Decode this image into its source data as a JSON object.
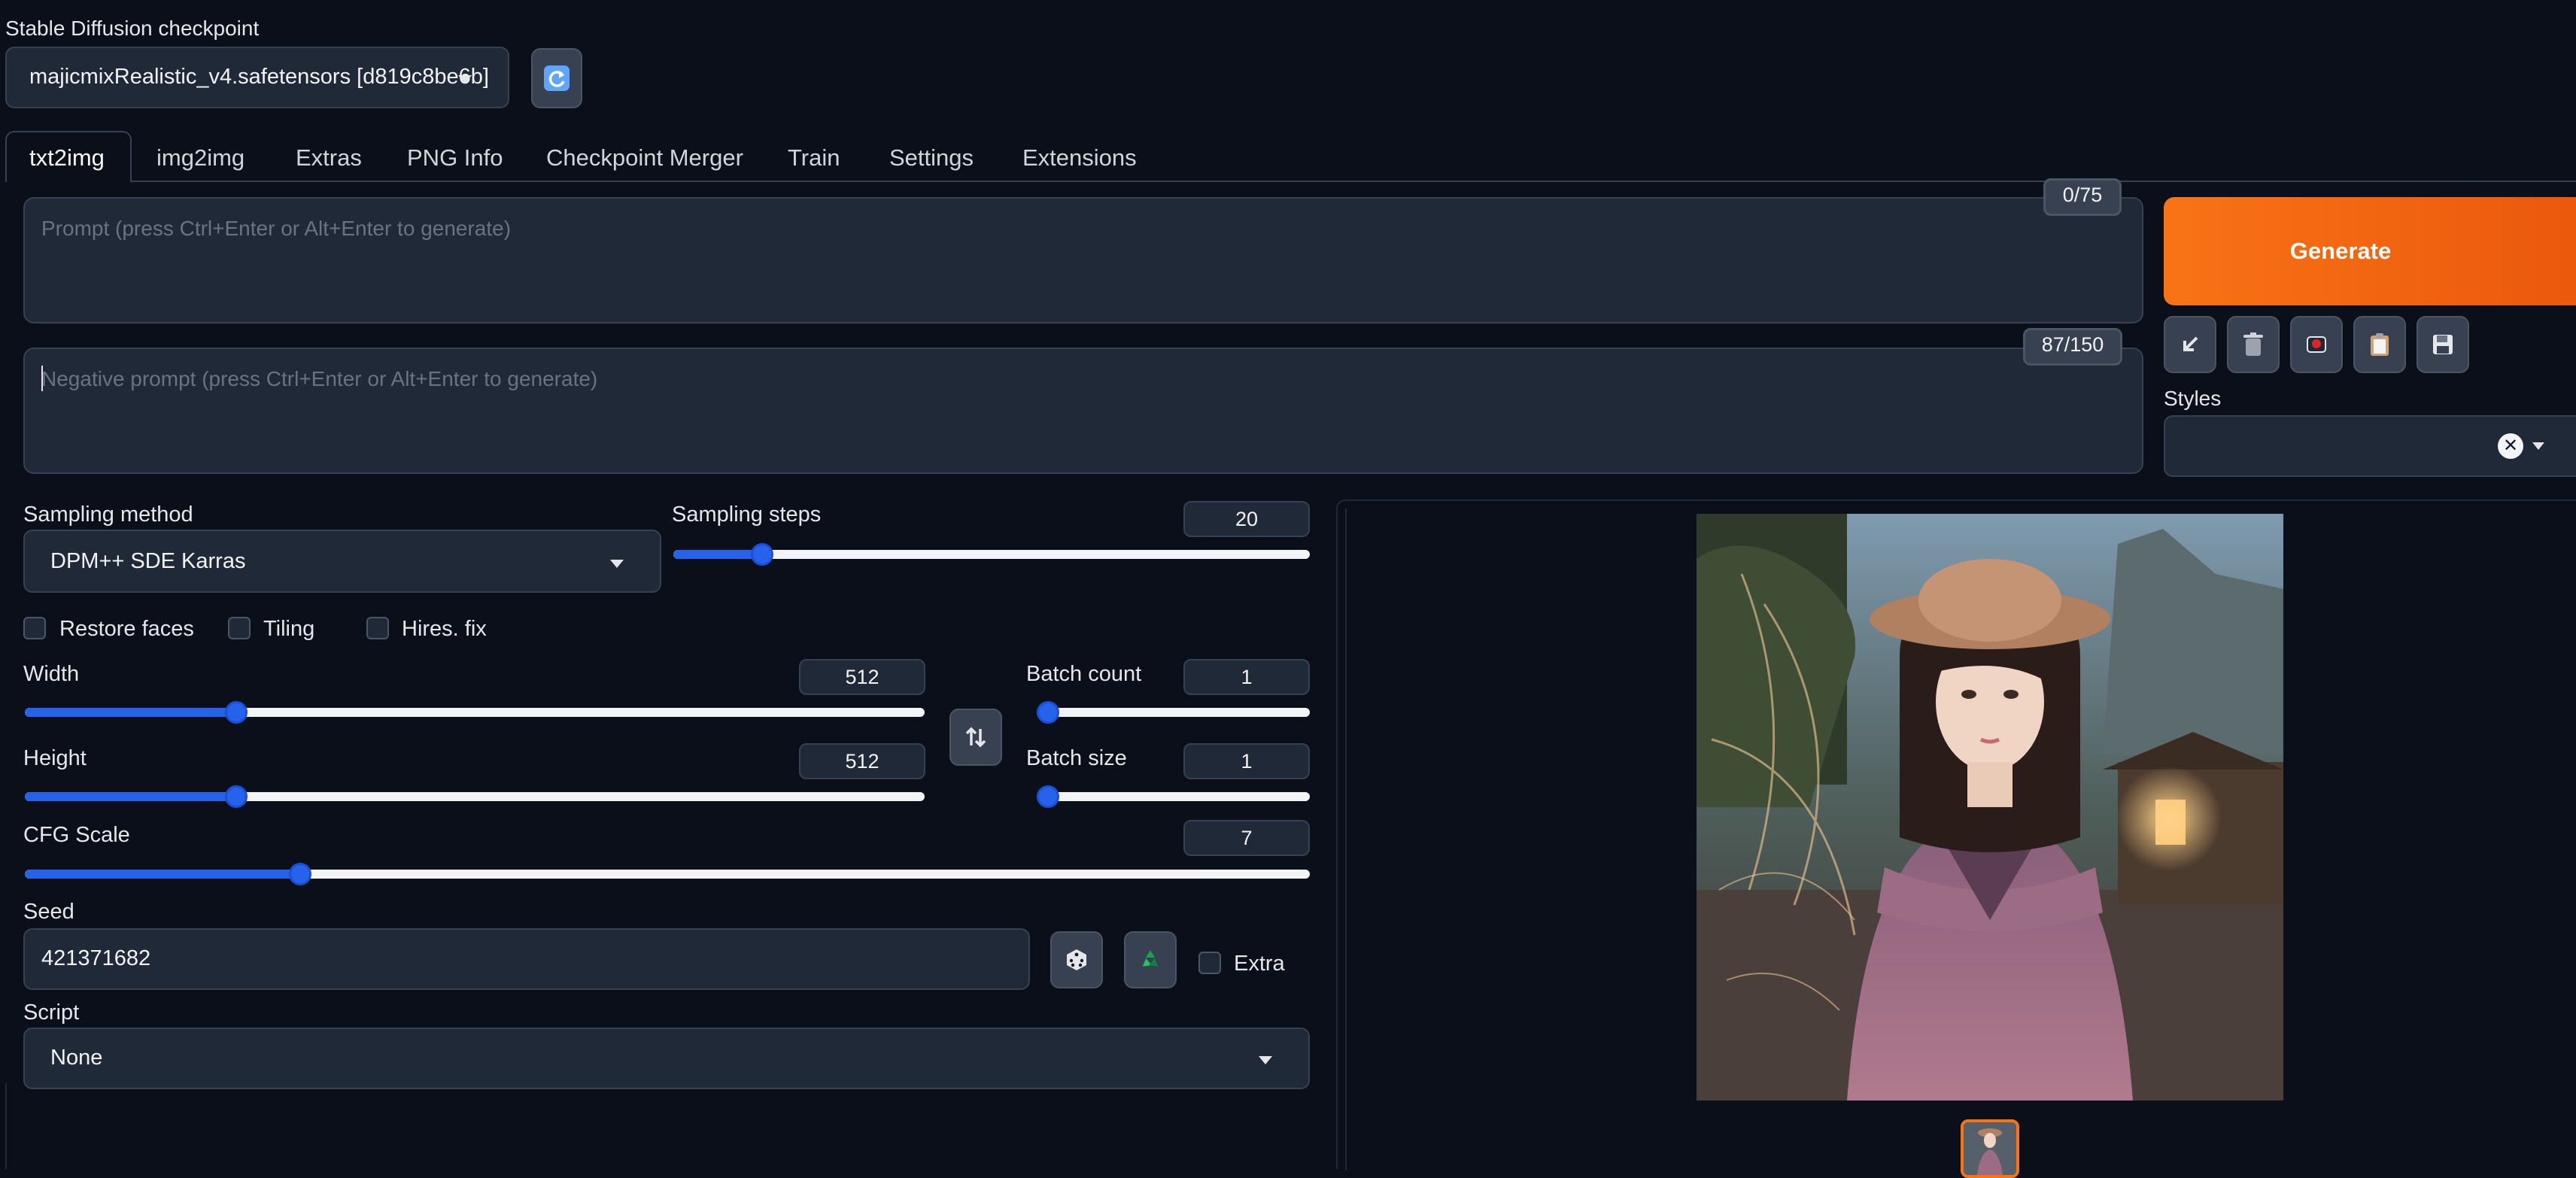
{
  "checkpoint": {
    "label": "Stable Diffusion checkpoint",
    "value": "majicmixRealistic_v4.safetensors [d819c8be6b]"
  },
  "tabs": [
    "txt2img",
    "img2img",
    "Extras",
    "PNG Info",
    "Checkpoint Merger",
    "Train",
    "Settings",
    "Extensions"
  ],
  "active_tab": "txt2img",
  "prompt": {
    "placeholder": "Prompt (press Ctrl+Enter or Alt+Enter to generate)",
    "value": "",
    "counter": "0/75"
  },
  "negative_prompt": {
    "placeholder": "Negative prompt (press Ctrl+Enter or Alt+Enter to generate)",
    "value": "",
    "counter": "87/150"
  },
  "generate_label": "Generate",
  "styles": {
    "label": "Styles",
    "value": ""
  },
  "sampling": {
    "method_label": "Sampling method",
    "method_value": "DPM++ SDE Karras",
    "steps_label": "Sampling steps",
    "steps_value": "20",
    "steps_fraction": 0.14
  },
  "checkboxes": {
    "restore_faces": "Restore faces",
    "tiling": "Tiling",
    "hires_fix": "Hires. fix",
    "extra": "Extra"
  },
  "width": {
    "label": "Width",
    "value": "512",
    "fraction": 0.235
  },
  "height": {
    "label": "Height",
    "value": "512",
    "fraction": 0.235
  },
  "batch_count": {
    "label": "Batch count",
    "value": "1",
    "fraction": 0.0
  },
  "batch_size": {
    "label": "Batch size",
    "value": "1",
    "fraction": 0.0
  },
  "cfg_scale": {
    "label": "CFG Scale",
    "value": "7",
    "fraction": 0.214
  },
  "seed": {
    "label": "Seed",
    "value": "421371682"
  },
  "script": {
    "label": "Script",
    "value": "None"
  },
  "colors": {
    "accent": "#2563eb",
    "generate": "#f97316",
    "background": "#0b0f19"
  },
  "icons": {
    "refresh": "refresh-icon",
    "swap": "swap-dimensions-icon",
    "dice": "dice-icon",
    "recycle": "recycle-icon",
    "arrow": "read-params-icon",
    "trash": "trash-icon",
    "extra_networks": "extra-networks-icon",
    "paste": "clipboard-icon",
    "save": "save-style-icon"
  }
}
